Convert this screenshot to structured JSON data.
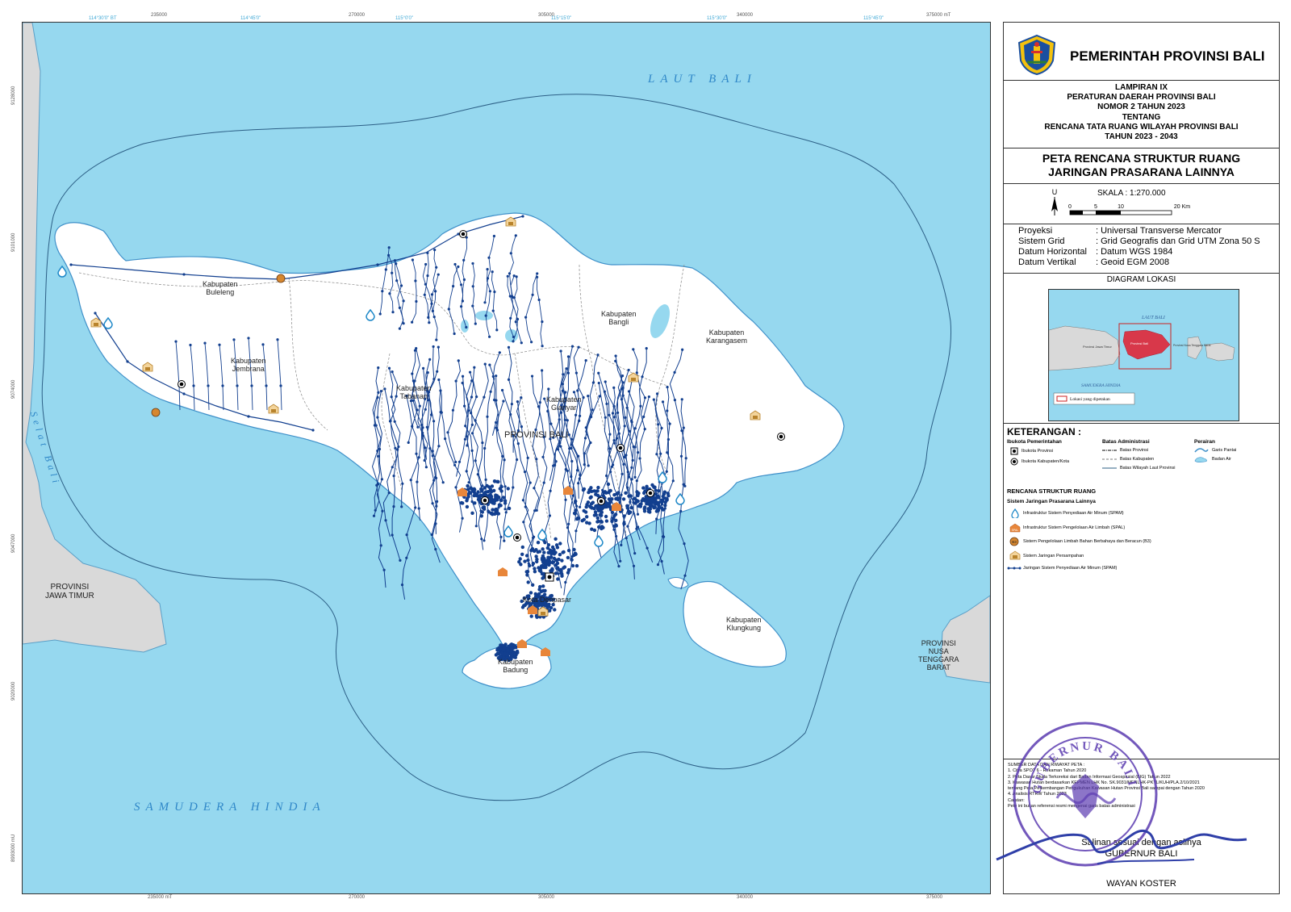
{
  "government": {
    "title": "PEMERINTAH PROVINSI BALI",
    "logo_icon": "bali-province-emblem-icon"
  },
  "lampiran": [
    "LAMPIRAN IX",
    "PERATURAN DAERAH PROVINSI BALI",
    "NOMOR  2  TAHUN 2023",
    "TENTANG",
    "RENCANA TATA RUANG WILAYAH PROVINSI BALI",
    "TAHUN 2023 - 2043"
  ],
  "map_title": [
    "PETA RENCANA STRUKTUR RUANG",
    "JARINGAN PRASARANA LAINNYA"
  ],
  "scale": {
    "label": "SKALA :  1:270.000",
    "north_letter": "U",
    "ticks": [
      "0",
      "5",
      "10",
      "20 Km"
    ]
  },
  "projection": [
    {
      "key": "Proyeksi",
      "value": ": Universal Transverse Mercator"
    },
    {
      "key": "Sistem Grid",
      "value": ": Grid Geografis dan Grid UTM Zona 50 S"
    },
    {
      "key": "Datum Horizontal",
      "value": ": Datum WGS 1984"
    },
    {
      "key": "Datum Vertikal",
      "value": ": Geoid EGM 2008"
    }
  ],
  "location_diagram": {
    "title": "DIAGRAM LOKASI",
    "sea_north": "LAUT BALI",
    "sea_south": "SAMUDERA HINDIA",
    "west_label": "Provinsi Jawa Timur",
    "center_label": "Provinsi Bali",
    "east_label": "Provinsi Nusa Tenggara Barat",
    "legend": "Lokasi yang dipetakan"
  },
  "legend": {
    "heading": "KETERANGAN :",
    "gov_heading": "Ibukota Pemerintahan",
    "gov_items": [
      "Ibukota Provinsi",
      "Ibukota Kabupaten/Kota"
    ],
    "admin_heading": "Batas Administrasi",
    "admin_items": [
      "Batas Provinsi",
      "Batas Kabupaten",
      "Batas Wilayah Laut Provinsi"
    ],
    "water_heading": "Perairan",
    "water_items": [
      "Garis Pantai",
      "Badan Air"
    ],
    "plan_heading": "RENCANA STRUKTUR RUANG",
    "plan_sub": "Sistem Jaringan Prasarana Lainnya",
    "plan_items": [
      {
        "label": "Infrastruktur Sistem Penyediaan Air Minum (SPAM)",
        "icon": "water-supply-icon"
      },
      {
        "label": "Infrastruktur Sistem Pengelolaan Air Limbah (SPAL)",
        "icon": "wastewater-icon"
      },
      {
        "label": "Sistem Pengelolaan Limbah Bahan Berbahaya dan Beracun (B3)",
        "icon": "hazardous-waste-icon"
      },
      {
        "label": "Sistem Jaringan Persampahan",
        "icon": "solid-waste-icon"
      },
      {
        "label": "Jaringan Sistem Penyediaan Air Minum (SPAM)",
        "icon": "water-pipe-line-icon"
      }
    ]
  },
  "sources": [
    "SUMBER DATA DAN RIWAYAT PETA :",
    "1. Citra SPOT 6 - Rekaman Tahun 2020",
    "2. Peta Dasar Skala Terkoreksi dari Badan Informasi Geospasial (BIG) Tahun 2022",
    "3. Kawasan Hutan berdasarkan KEPMEN LHK No. SK.9031/MENLHK-PKTL/KUH/PLA.2/10/2021",
    "   tentang Peta Perkembangan Pengukuhan Kawasan Hutan Provinsi Bali sampai dengan Tahun 2020",
    "4. Analisis RTRW Tahun 2023",
    "Catatan:",
    "Pete ini bukan referensi resmi mengenai garis batas administrasi"
  ],
  "signature": {
    "line1": "Salinan sesuai dengan aslinya",
    "line2": "GUBERNUR BALI",
    "name": "WAYAN KOSTER",
    "stamp_text": "GUBERNUR BALI"
  },
  "map_labels": {
    "sea_north": "LAUT BALI",
    "sea_south": "SAMUDERA HINDIA",
    "strait": "Selat Bali",
    "province": "PROVINSI BALI",
    "west_province": [
      "PROVINSI",
      "JAWA TIMUR"
    ],
    "east_province": [
      "PROVINSI",
      "NUSA",
      "TENGGARA",
      "BARAT"
    ],
    "regencies": [
      [
        "Kabupaten",
        "Buleleng"
      ],
      [
        "Kabupaten",
        "Jembrana"
      ],
      [
        "Kabupaten",
        "Tabanan"
      ],
      [
        "Kabupaten",
        "Gianyar"
      ],
      [
        "Kabupaten",
        "Bangli"
      ],
      [
        "Kabupaten",
        "Karangasem"
      ],
      [
        "Kabupaten",
        "Klungkung"
      ],
      [
        "Kota Denpasar"
      ],
      [
        "Kabupaten",
        "Badung"
      ]
    ]
  },
  "grid": {
    "top_utm": [
      "235000",
      "270000",
      "305000",
      "340000",
      "375000 mT"
    ],
    "bottom_utm": [
      "235000 mT",
      "270000",
      "305000",
      "340000",
      "375000"
    ],
    "top_dms": [
      "114°30'0\" BT",
      "114°45'0\"",
      "115°0'0\"",
      "115°15'0\"",
      "115°30'0\"",
      "115°45'0\""
    ],
    "left_utm": [
      "9128000",
      "9101000",
      "9074000",
      "9047000",
      "9020000",
      "8993000 mU"
    ]
  },
  "colors": {
    "sea": "#96d8ef",
    "land": "#ffffff",
    "neighbor": "#d9d9d9",
    "pipeline": "#123f8f",
    "wastewater": "#e8863a",
    "stamp": "#5b3bb0"
  }
}
